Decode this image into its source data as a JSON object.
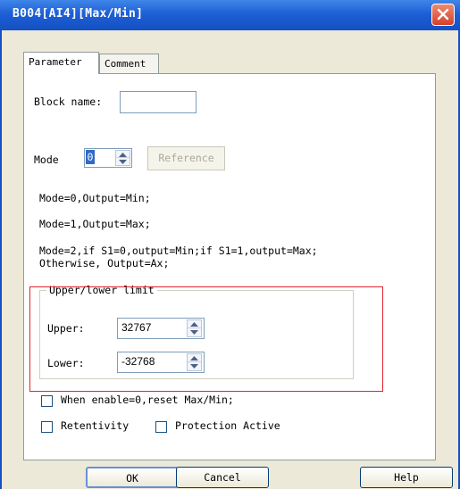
{
  "window": {
    "title": "B004[AI4][Max/Min]"
  },
  "tabs": [
    {
      "label": "Parameter",
      "active": true
    },
    {
      "label": "Comment",
      "active": false
    }
  ],
  "block_name": {
    "label": "Block name:",
    "value": ""
  },
  "mode": {
    "label": "Mode",
    "value": "0",
    "reference_label": "Reference"
  },
  "descriptions": {
    "line1": "Mode=0,Output=Min;",
    "line2": "Mode=1,Output=Max;",
    "line3a": "Mode=2,if S1=0,output=Min;if S1=1,output=Max;",
    "line3b": "Otherwise, Output=Ax;"
  },
  "limits": {
    "group_title": "Upper/lower limit",
    "upper_label": "Upper:",
    "upper_value": "32767",
    "lower_label": "Lower:",
    "lower_value": "-32768"
  },
  "options": {
    "reset_label": "When enable=0,reset Max/Min;",
    "reset_checked": false,
    "retentivity_label": "Retentivity",
    "retentivity_checked": false,
    "protection_label": "Protection Active",
    "protection_checked": false
  },
  "buttons": {
    "ok": "OK",
    "cancel": "Cancel",
    "help": "Help"
  },
  "colors": {
    "titlebar": "#1e5fd6",
    "highlight_box": "#e0252b",
    "window_bg": "#ece9d8"
  }
}
